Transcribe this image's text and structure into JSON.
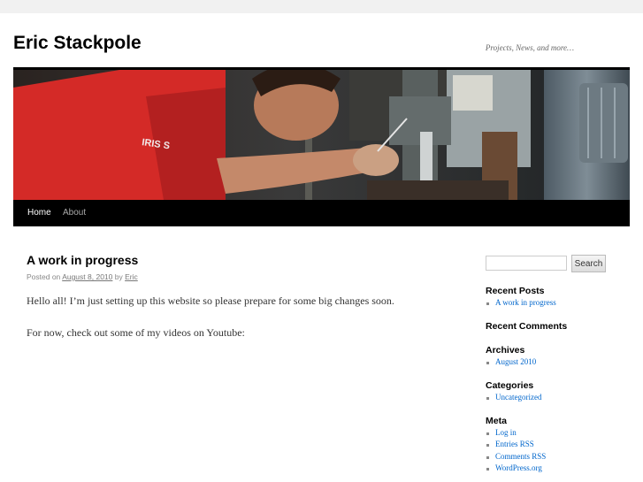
{
  "site": {
    "title": "Eric Stackpole",
    "description": "Projects, News, and more…"
  },
  "nav": {
    "items": [
      {
        "label": "Home",
        "current": true
      },
      {
        "label": "About",
        "current": false
      }
    ]
  },
  "post": {
    "title": "A work in progress",
    "meta": {
      "posted_on": "Posted on",
      "date": "August 8, 2010",
      "by": "by",
      "author": "Eric"
    },
    "paragraphs": [
      "Hello all!  I’m just setting up this website so please prepare for some big changes soon.",
      "For now, check out some of my videos on Youtube:"
    ]
  },
  "sidebar": {
    "search": {
      "placeholder": "",
      "button_label": "Search"
    },
    "recent_posts": {
      "title": "Recent Posts",
      "items": [
        "A work in progress"
      ]
    },
    "recent_comments": {
      "title": "Recent Comments"
    },
    "archives": {
      "title": "Archives",
      "items": [
        "August 2010"
      ]
    },
    "categories": {
      "title": "Categories",
      "items": [
        "Uncategorized"
      ]
    },
    "meta": {
      "title": "Meta",
      "items": [
        "Log in",
        "Entries RSS",
        "Comments RSS",
        "WordPress.org"
      ]
    }
  },
  "colors": {
    "link": "#0066cc",
    "nav_bg": "#000000",
    "page_bg": "#f1f1f1"
  }
}
